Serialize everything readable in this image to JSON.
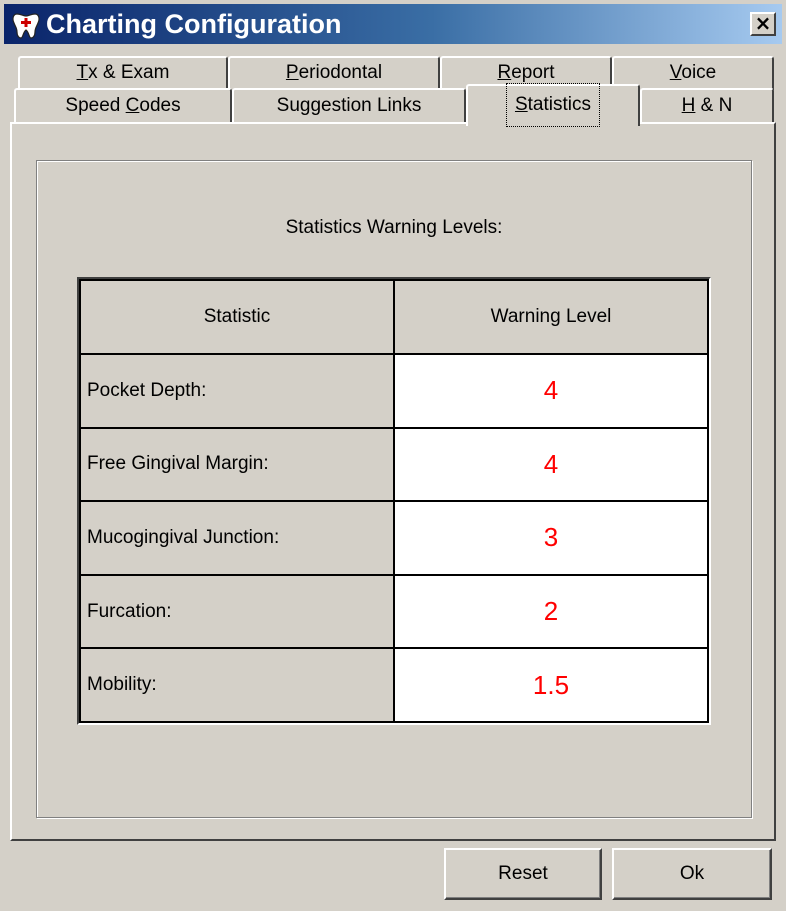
{
  "window": {
    "title": "Charting Configuration",
    "close_glyph": "×"
  },
  "tabs": {
    "row1": [
      {
        "label": "Tx & Exam",
        "mnemonic": "T"
      },
      {
        "label": "Periodontal",
        "mnemonic": "P"
      },
      {
        "label": "Report",
        "mnemonic": "R"
      },
      {
        "label": "Voice",
        "mnemonic": "V"
      }
    ],
    "row2": [
      {
        "label": "Speed Codes",
        "mnemonic": "C"
      },
      {
        "label": "Suggestion Links",
        "mnemonic": ""
      },
      {
        "label": "Statistics",
        "mnemonic": "S",
        "active": true
      },
      {
        "label": "H & N",
        "mnemonic": "H"
      }
    ]
  },
  "statistics": {
    "caption": "Statistics Warning Levels:",
    "headers": {
      "statistic": "Statistic",
      "warning_level": "Warning Level"
    },
    "rows": [
      {
        "name": "Pocket Depth:",
        "value": "4"
      },
      {
        "name": "Free Gingival Margin:",
        "value": "4"
      },
      {
        "name": "Mucogingival Junction:",
        "value": "3"
      },
      {
        "name": "Furcation:",
        "value": "2"
      },
      {
        "name": "Mobility:",
        "value": "1.5"
      }
    ]
  },
  "buttons": {
    "reset": "Reset",
    "ok": "Ok"
  },
  "colors": {
    "warning_value": "#ff0000",
    "titlebar_start": "#0a246a",
    "face": "#d4d0c8"
  }
}
